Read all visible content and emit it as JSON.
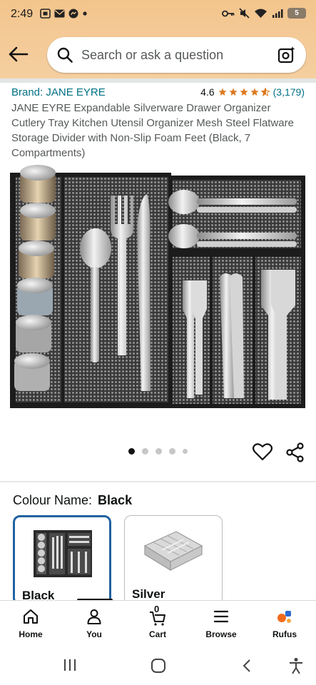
{
  "status_bar": {
    "time": "2:49",
    "battery": "5",
    "icons": [
      "screenshot-icon",
      "mail-icon",
      "messenger-icon",
      "dot-icon",
      "key-icon",
      "mute-icon",
      "wifi-icon",
      "signal-icon",
      "battery-icon"
    ]
  },
  "search": {
    "placeholder": "Search or ask a question"
  },
  "product": {
    "brand": "Brand: JANE EYRE",
    "rating": "4.6",
    "rating_count": "(3,179)",
    "stars": 4.6,
    "title": "JANE EYRE Expandable Silverware Drawer Organizer Cutlery Tray Kitchen Utensil Organizer Mesh Steel Flatware Storage Divider with Non-Slip Foam Feet (Black, 7 Compartments)"
  },
  "gallery": {
    "total_images": 5,
    "active_index": 0
  },
  "colour": {
    "label": "Colour Name:",
    "selected": "Black",
    "options": [
      {
        "name": "Black",
        "selected": true
      },
      {
        "name": "Silver",
        "selected": false
      }
    ]
  },
  "bottom_nav": {
    "items": [
      {
        "label": "Home",
        "icon": "home-icon"
      },
      {
        "label": "You",
        "icon": "user-icon"
      },
      {
        "label": "Cart",
        "icon": "cart-icon",
        "count": "0"
      },
      {
        "label": "Browse",
        "icon": "menu-icon"
      },
      {
        "label": "Rufus",
        "icon": "rufus-icon"
      }
    ],
    "active": "You"
  },
  "colors": {
    "header": "#f3c58d",
    "link": "#007185",
    "star": "#de7921",
    "selected_border": "#2162a1"
  }
}
